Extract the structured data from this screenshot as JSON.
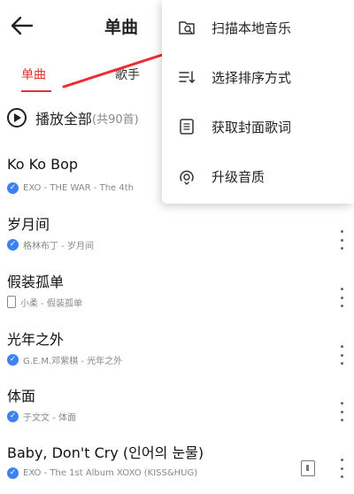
{
  "header": {
    "title": "单曲"
  },
  "tabs": [
    {
      "label": "单曲",
      "active": true
    },
    {
      "label": "歌手",
      "active": false
    }
  ],
  "play_all": {
    "label": "播放全部",
    "count": "(共90首)"
  },
  "songs": [
    {
      "title": "Ko Ko Bop",
      "meta": "EXO - THE WAR - The 4th",
      "badge": "verified",
      "more": true,
      "mv": false
    },
    {
      "title": "岁月间",
      "meta": "格林布丁 - 岁月间",
      "badge": "verified",
      "more": true,
      "mv": false
    },
    {
      "title": "假装孤单",
      "meta": "小柔 - 假装孤单",
      "badge": "local",
      "more": true,
      "mv": false
    },
    {
      "title": "光年之外",
      "meta": "G.E.M.邓紫棋 - 光年之外",
      "badge": "verified",
      "more": true,
      "mv": false
    },
    {
      "title": "体面",
      "meta": "于文文 - 体面",
      "badge": "verified",
      "more": true,
      "mv": false
    },
    {
      "title": "Baby, Don't Cry (인어의 눈물)",
      "meta": "EXO - The 1st Album XOXO (KISS&HUG)",
      "badge": "verified",
      "more": true,
      "mv": true
    }
  ],
  "menu": {
    "items": [
      {
        "label": "扫描本地音乐",
        "icon": "scan-folder-icon"
      },
      {
        "label": "选择排序方式",
        "icon": "sort-icon"
      },
      {
        "label": "获取封面歌词",
        "icon": "lyrics-cover-icon"
      },
      {
        "label": "升级音质",
        "icon": "quality-upgrade-icon"
      }
    ]
  },
  "colors": {
    "accent": "#e3342f",
    "verified": "#3b82f6",
    "text": "#222222",
    "muted": "#888888"
  }
}
